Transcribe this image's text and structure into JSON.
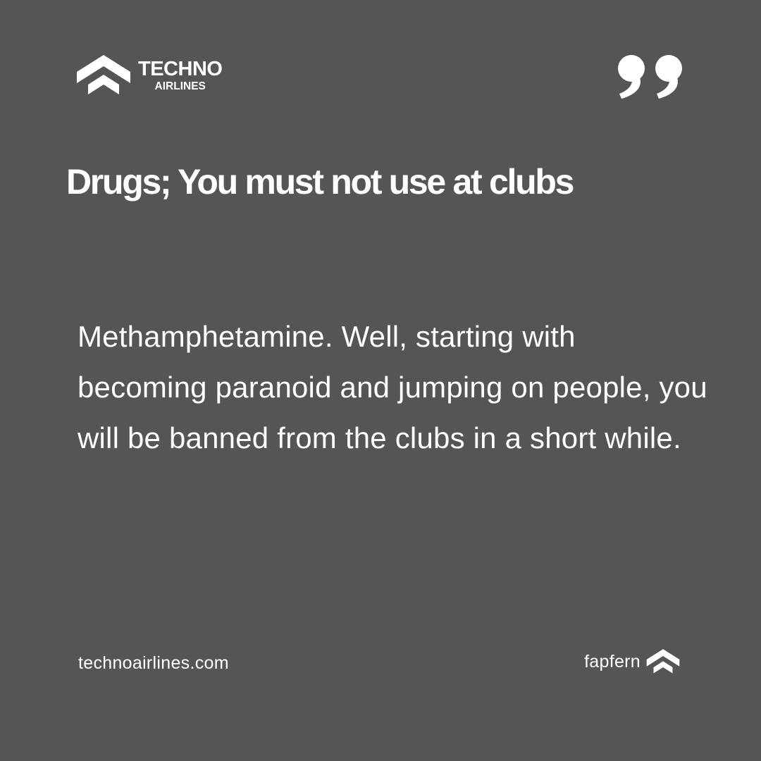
{
  "brand": {
    "line1": "TECHNO",
    "line2": "AIRLINES",
    "logo_icon": "chevron-stack-logo-icon"
  },
  "quote_icon": "closing-quote-icon",
  "headline": "Drugs; You must not use at clubs",
  "body": "Methamphetamine. Well, starting with becoming paranoid and jumping on people, you will be banned from the clubs in a short while.",
  "footer": {
    "website": "technoairlines.com",
    "author": "fapfern",
    "author_icon": "chevron-stack-icon"
  },
  "colors": {
    "background": "#555555",
    "text": "#ffffff"
  }
}
